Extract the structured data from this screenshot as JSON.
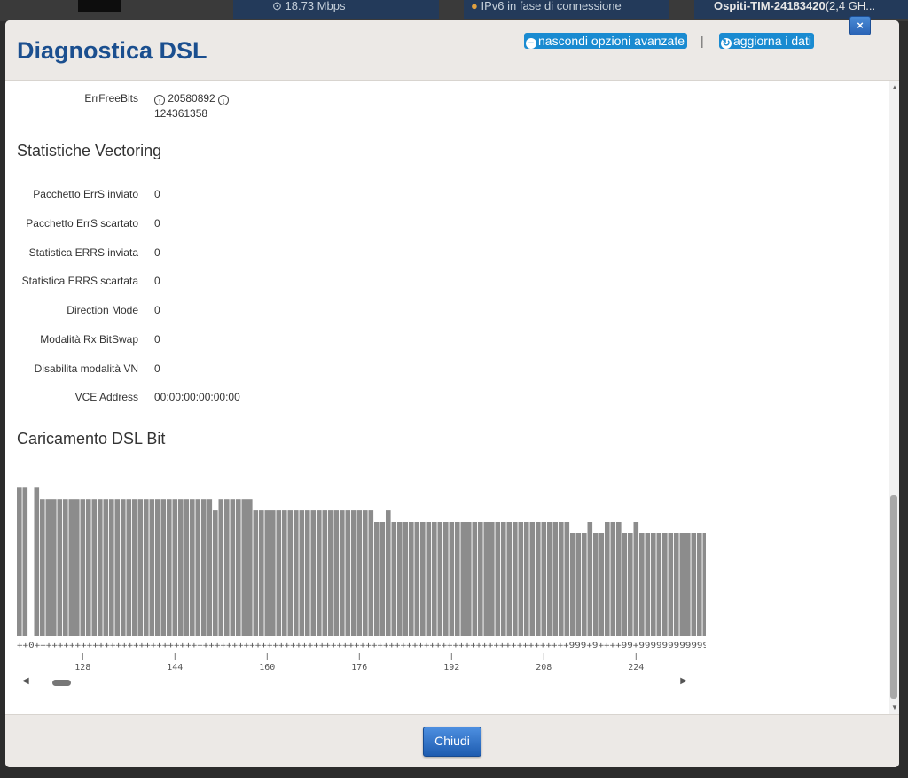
{
  "background": {
    "speed": "18.73 Mbps",
    "ipv6_status": "IPv6 in fase di connessione",
    "ssid_name": "Ospiti-TIM-24183420",
    "ssid_band": "(2,4 GH..."
  },
  "modal": {
    "title": "Diagnostica DSL",
    "hide_advanced_label": "nascondi opzioni avanzate",
    "separator": "|",
    "refresh_label": "aggiorna i dati",
    "close_symbol": "×"
  },
  "errfreebits": {
    "label": "ErrFreeBits",
    "up_value": "20580892",
    "down_value": "124361358"
  },
  "vectoring": {
    "title": "Statistiche Vectoring",
    "rows": [
      {
        "label": "Pacchetto ErrS inviato",
        "value": "0"
      },
      {
        "label": "Pacchetto ErrS scartato",
        "value": "0"
      },
      {
        "label": "Statistica ERRS inviata",
        "value": "0"
      },
      {
        "label": "Statistica ERRS scartata",
        "value": "0"
      },
      {
        "label": "Direction Mode",
        "value": "0"
      },
      {
        "label": "Modalità Rx BitSwap",
        "value": "0"
      },
      {
        "label": "Disabilita modalità VN",
        "value": "0"
      },
      {
        "label": "VCE Address",
        "value": "00:00:00:00:00:00"
      }
    ]
  },
  "bitloading": {
    "title": "Caricamento DSL Bit"
  },
  "chart_data": {
    "type": "bar",
    "x_start": 117,
    "values": [
      13,
      13,
      0,
      13,
      12,
      12,
      12,
      12,
      12,
      12,
      12,
      12,
      12,
      12,
      12,
      12,
      12,
      12,
      12,
      12,
      12,
      12,
      12,
      12,
      12,
      12,
      12,
      12,
      12,
      12,
      12,
      12,
      12,
      12,
      11,
      12,
      12,
      12,
      12,
      12,
      12,
      11,
      11,
      11,
      11,
      11,
      11,
      11,
      11,
      11,
      11,
      11,
      11,
      11,
      11,
      11,
      11,
      11,
      11,
      11,
      11,
      11,
      10,
      10,
      11,
      10,
      10,
      10,
      10,
      10,
      10,
      10,
      10,
      10,
      10,
      10,
      10,
      10,
      10,
      10,
      10,
      10,
      10,
      10,
      10,
      10,
      10,
      10,
      10,
      10,
      10,
      10,
      10,
      10,
      10,
      10,
      9,
      9,
      9,
      10,
      9,
      9,
      10,
      10,
      10,
      9,
      9,
      10,
      9,
      9,
      9,
      9,
      9,
      9,
      9,
      9,
      9,
      9,
      9,
      9
    ],
    "markers": "++0++++++++++++++++++++++++++++++++++++++++++++++++++++++++++++++++++++++++++++++++++++++++++++999+9++++99+999999999999",
    "xticks": [
      "128",
      "144",
      "160",
      "176",
      "192",
      "208",
      "224"
    ],
    "ylim": [
      0,
      13
    ]
  },
  "footer": {
    "close_label": "Chiudi"
  },
  "colors": {
    "title_blue": "#1b4f8f",
    "link_blue": "#1a8bd1",
    "bar_gray": "#8c8c8c"
  }
}
